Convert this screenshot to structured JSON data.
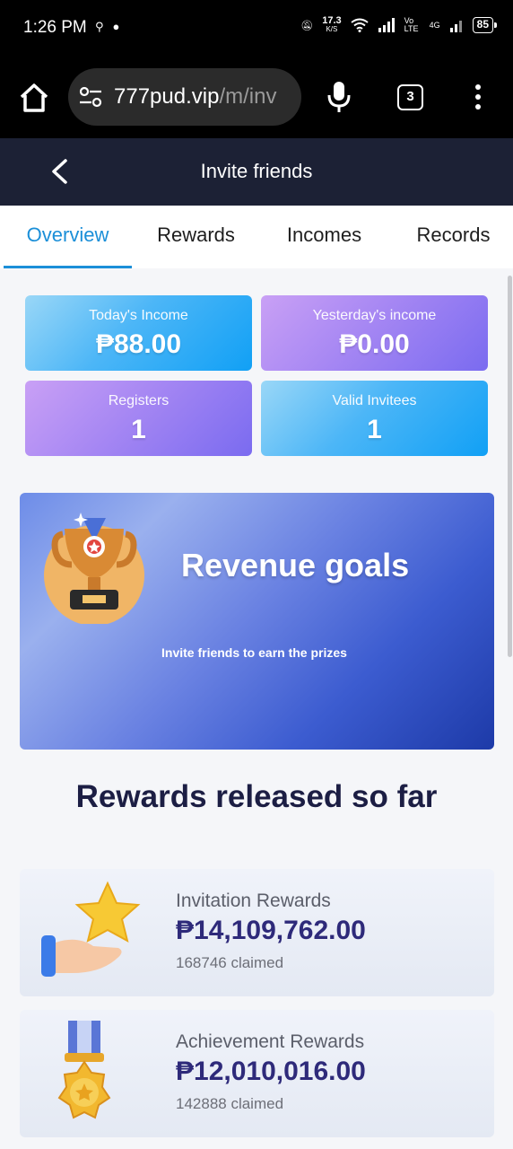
{
  "status_bar": {
    "time": "1:26 PM",
    "speed_value": "17.3",
    "speed_unit": "K/S",
    "network_label": "Vo LTE",
    "network_4g": "4G",
    "battery": "85"
  },
  "browser": {
    "url_host": "777pud.vip",
    "url_path": "/m/inv",
    "tab_count": "3"
  },
  "header": {
    "title": "Invite friends"
  },
  "tabs": [
    {
      "label": "Overview",
      "active": true
    },
    {
      "label": "Rewards",
      "active": false
    },
    {
      "label": "Incomes",
      "active": false
    },
    {
      "label": "Records",
      "active": false
    }
  ],
  "stats": {
    "today_income": {
      "label": "Today's Income",
      "value": "₱88.00"
    },
    "yesterday_income": {
      "label": "Yesterday's income",
      "value": "₱0.00"
    },
    "registers": {
      "label": "Registers",
      "value": "1"
    },
    "valid_invitees": {
      "label": "Valid Invitees",
      "value": "1"
    }
  },
  "banner": {
    "title": "Revenue goals",
    "subtitle": "Invite friends to earn the prizes"
  },
  "rewards_section": {
    "title": "Rewards released so far",
    "items": [
      {
        "name": "Invitation Rewards",
        "amount": "₱14,109,762.00",
        "claimed": "168746 claimed"
      },
      {
        "name": "Achievement Rewards",
        "amount": "₱12,010,016.00",
        "claimed": "142888 claimed"
      }
    ]
  },
  "colors": {
    "accent": "#1b8fd8",
    "header_bg": "#1c2135",
    "amount_text": "#2e2a7a"
  },
  "icons": [
    "home-icon",
    "tune-icon",
    "mic-icon",
    "tabs-icon",
    "more-icon",
    "back-icon",
    "trophy-icon",
    "star-hand-icon",
    "medal-icon"
  ]
}
